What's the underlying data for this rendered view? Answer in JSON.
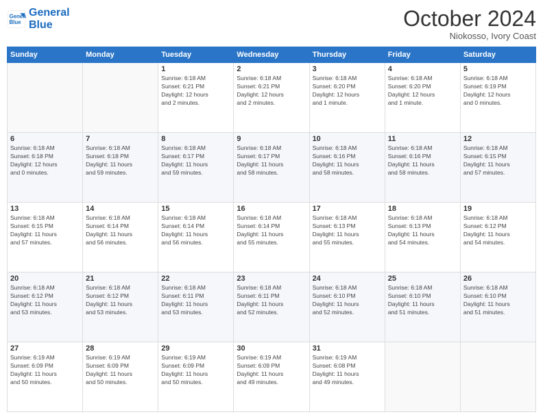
{
  "header": {
    "logo": {
      "line1": "General",
      "line2": "Blue"
    },
    "title": "October 2024",
    "location": "Niokosso, Ivory Coast"
  },
  "weekdays": [
    "Sunday",
    "Monday",
    "Tuesday",
    "Wednesday",
    "Thursday",
    "Friday",
    "Saturday"
  ],
  "weeks": [
    [
      {
        "day": "",
        "info": ""
      },
      {
        "day": "",
        "info": ""
      },
      {
        "day": "1",
        "info": "Sunrise: 6:18 AM\nSunset: 6:21 PM\nDaylight: 12 hours\nand 2 minutes."
      },
      {
        "day": "2",
        "info": "Sunrise: 6:18 AM\nSunset: 6:21 PM\nDaylight: 12 hours\nand 2 minutes."
      },
      {
        "day": "3",
        "info": "Sunrise: 6:18 AM\nSunset: 6:20 PM\nDaylight: 12 hours\nand 1 minute."
      },
      {
        "day": "4",
        "info": "Sunrise: 6:18 AM\nSunset: 6:20 PM\nDaylight: 12 hours\nand 1 minute."
      },
      {
        "day": "5",
        "info": "Sunrise: 6:18 AM\nSunset: 6:19 PM\nDaylight: 12 hours\nand 0 minutes."
      }
    ],
    [
      {
        "day": "6",
        "info": "Sunrise: 6:18 AM\nSunset: 6:18 PM\nDaylight: 12 hours\nand 0 minutes."
      },
      {
        "day": "7",
        "info": "Sunrise: 6:18 AM\nSunset: 6:18 PM\nDaylight: 11 hours\nand 59 minutes."
      },
      {
        "day": "8",
        "info": "Sunrise: 6:18 AM\nSunset: 6:17 PM\nDaylight: 11 hours\nand 59 minutes."
      },
      {
        "day": "9",
        "info": "Sunrise: 6:18 AM\nSunset: 6:17 PM\nDaylight: 11 hours\nand 58 minutes."
      },
      {
        "day": "10",
        "info": "Sunrise: 6:18 AM\nSunset: 6:16 PM\nDaylight: 11 hours\nand 58 minutes."
      },
      {
        "day": "11",
        "info": "Sunrise: 6:18 AM\nSunset: 6:16 PM\nDaylight: 11 hours\nand 58 minutes."
      },
      {
        "day": "12",
        "info": "Sunrise: 6:18 AM\nSunset: 6:15 PM\nDaylight: 11 hours\nand 57 minutes."
      }
    ],
    [
      {
        "day": "13",
        "info": "Sunrise: 6:18 AM\nSunset: 6:15 PM\nDaylight: 11 hours\nand 57 minutes."
      },
      {
        "day": "14",
        "info": "Sunrise: 6:18 AM\nSunset: 6:14 PM\nDaylight: 11 hours\nand 56 minutes."
      },
      {
        "day": "15",
        "info": "Sunrise: 6:18 AM\nSunset: 6:14 PM\nDaylight: 11 hours\nand 56 minutes."
      },
      {
        "day": "16",
        "info": "Sunrise: 6:18 AM\nSunset: 6:14 PM\nDaylight: 11 hours\nand 55 minutes."
      },
      {
        "day": "17",
        "info": "Sunrise: 6:18 AM\nSunset: 6:13 PM\nDaylight: 11 hours\nand 55 minutes."
      },
      {
        "day": "18",
        "info": "Sunrise: 6:18 AM\nSunset: 6:13 PM\nDaylight: 11 hours\nand 54 minutes."
      },
      {
        "day": "19",
        "info": "Sunrise: 6:18 AM\nSunset: 6:12 PM\nDaylight: 11 hours\nand 54 minutes."
      }
    ],
    [
      {
        "day": "20",
        "info": "Sunrise: 6:18 AM\nSunset: 6:12 PM\nDaylight: 11 hours\nand 53 minutes."
      },
      {
        "day": "21",
        "info": "Sunrise: 6:18 AM\nSunset: 6:12 PM\nDaylight: 11 hours\nand 53 minutes."
      },
      {
        "day": "22",
        "info": "Sunrise: 6:18 AM\nSunset: 6:11 PM\nDaylight: 11 hours\nand 53 minutes."
      },
      {
        "day": "23",
        "info": "Sunrise: 6:18 AM\nSunset: 6:11 PM\nDaylight: 11 hours\nand 52 minutes."
      },
      {
        "day": "24",
        "info": "Sunrise: 6:18 AM\nSunset: 6:10 PM\nDaylight: 11 hours\nand 52 minutes."
      },
      {
        "day": "25",
        "info": "Sunrise: 6:18 AM\nSunset: 6:10 PM\nDaylight: 11 hours\nand 51 minutes."
      },
      {
        "day": "26",
        "info": "Sunrise: 6:18 AM\nSunset: 6:10 PM\nDaylight: 11 hours\nand 51 minutes."
      }
    ],
    [
      {
        "day": "27",
        "info": "Sunrise: 6:19 AM\nSunset: 6:09 PM\nDaylight: 11 hours\nand 50 minutes."
      },
      {
        "day": "28",
        "info": "Sunrise: 6:19 AM\nSunset: 6:09 PM\nDaylight: 11 hours\nand 50 minutes."
      },
      {
        "day": "29",
        "info": "Sunrise: 6:19 AM\nSunset: 6:09 PM\nDaylight: 11 hours\nand 50 minutes."
      },
      {
        "day": "30",
        "info": "Sunrise: 6:19 AM\nSunset: 6:09 PM\nDaylight: 11 hours\nand 49 minutes."
      },
      {
        "day": "31",
        "info": "Sunrise: 6:19 AM\nSunset: 6:08 PM\nDaylight: 11 hours\nand 49 minutes."
      },
      {
        "day": "",
        "info": ""
      },
      {
        "day": "",
        "info": ""
      }
    ]
  ]
}
